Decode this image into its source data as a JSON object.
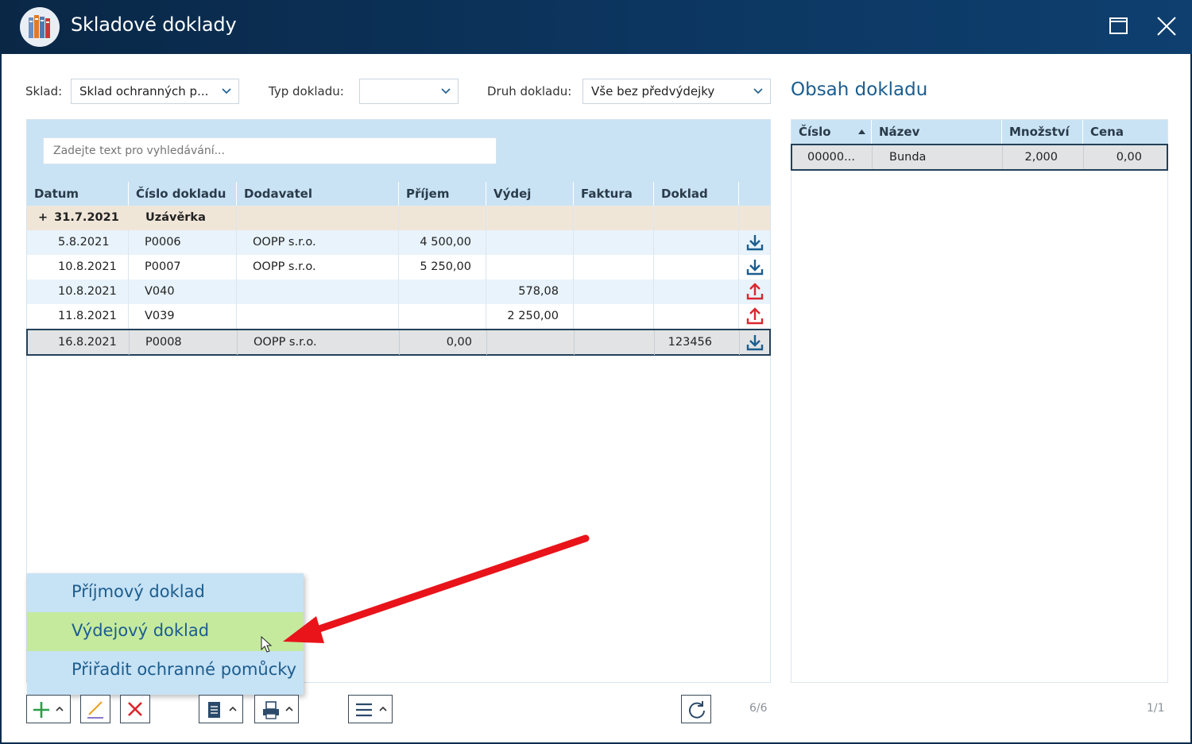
{
  "window": {
    "title": "Skladové doklady"
  },
  "filters": {
    "sklad_label": "Sklad:",
    "sklad_value": "Sklad ochranných p...",
    "typ_label": "Typ dokladu:",
    "typ_value": "",
    "druh_label": "Druh dokladu:",
    "druh_value": "Vše bez předvýdejky"
  },
  "search": {
    "placeholder": "Zadejte text pro vyhledávání..."
  },
  "grid": {
    "columns": [
      "Datum",
      "Číslo dokladu",
      "Dodavatel",
      "Příjem",
      "Výdej",
      "Faktura",
      "Doklad"
    ],
    "group": {
      "expander": "+",
      "date": "31.7.2021",
      "label": "Uzávěrka"
    },
    "rows": [
      {
        "datum": "5.8.2021",
        "cislo": "P0006",
        "dodavatel": "OOPP s.r.o.",
        "prijem": "4 500,00",
        "vydej": "",
        "faktura": "",
        "doklad": "",
        "icon": "download-icon"
      },
      {
        "datum": "10.8.2021",
        "cislo": "P0007",
        "dodavatel": "OOPP s.r.o.",
        "prijem": "5 250,00",
        "vydej": "",
        "faktura": "",
        "doklad": "",
        "icon": "download-icon"
      },
      {
        "datum": "10.8.2021",
        "cislo": "V040",
        "dodavatel": "",
        "prijem": "",
        "vydej": "578,08",
        "faktura": "",
        "doklad": "",
        "icon": "upload-icon"
      },
      {
        "datum": "11.8.2021",
        "cislo": "V039",
        "dodavatel": "",
        "prijem": "",
        "vydej": "2 250,00",
        "faktura": "",
        "doklad": "",
        "icon": "upload-icon"
      },
      {
        "datum": "16.8.2021",
        "cislo": "P0008",
        "dodavatel": "OOPP s.r.o.",
        "prijem": "0,00",
        "vydej": "",
        "faktura": "",
        "doklad": "123456",
        "icon": "download-icon"
      }
    ],
    "counter": "6/6"
  },
  "detail": {
    "title": "Obsah dokladu",
    "columns": [
      "Číslo",
      "Název",
      "Množství",
      "Cena"
    ],
    "row": {
      "cislo": "00000...",
      "nazev": "Bunda",
      "mnozstvi": "2,000",
      "cena": "0,00"
    },
    "counter": "1/1"
  },
  "popup_menu": {
    "items": [
      "Příjmový doklad",
      "Výdejový doklad",
      "Přiřadit ochranné pomůcky"
    ]
  },
  "colors": {
    "titlebar": "#0c3762",
    "accent": "#1c5d8e",
    "header_bg": "#c9e3f5",
    "highlight": "#c5ea9e",
    "download": "#1c5d8e",
    "upload": "#d9272e",
    "arrow": "#e8141a"
  }
}
